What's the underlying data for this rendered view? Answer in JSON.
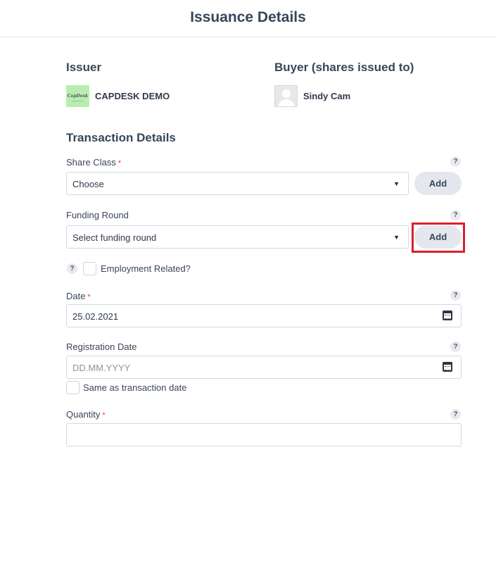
{
  "header": {
    "title": "Issuance Details"
  },
  "issuer": {
    "heading": "Issuer",
    "name": "CAPDESK DEMO",
    "logo_text": "CapDesk"
  },
  "buyer": {
    "heading": "Buyer (shares issued to)",
    "name": "Sindy Cam"
  },
  "transaction": {
    "heading": "Transaction Details",
    "share_class": {
      "label": "Share Class",
      "required": "*",
      "value": "Choose",
      "add_label": "Add",
      "help": "?"
    },
    "funding_round": {
      "label": "Funding Round",
      "value": "Select funding round",
      "add_label": "Add",
      "help": "?"
    },
    "employment": {
      "label": "Employment Related?",
      "help": "?",
      "checked": false
    },
    "date": {
      "label": "Date",
      "required": "*",
      "value": "25.02.2021",
      "help": "?"
    },
    "registration_date": {
      "label": "Registration Date",
      "placeholder": "DD.MM.YYYY",
      "help": "?"
    },
    "same_as_transaction": {
      "label": "Same as transaction date",
      "checked": false
    },
    "quantity": {
      "label": "Quantity",
      "required": "*",
      "value": "",
      "help": "?"
    }
  },
  "colors": {
    "highlight": "#dd1f2b",
    "issuer_logo_bg": "#b7eeb0",
    "required": "#e0394f"
  }
}
